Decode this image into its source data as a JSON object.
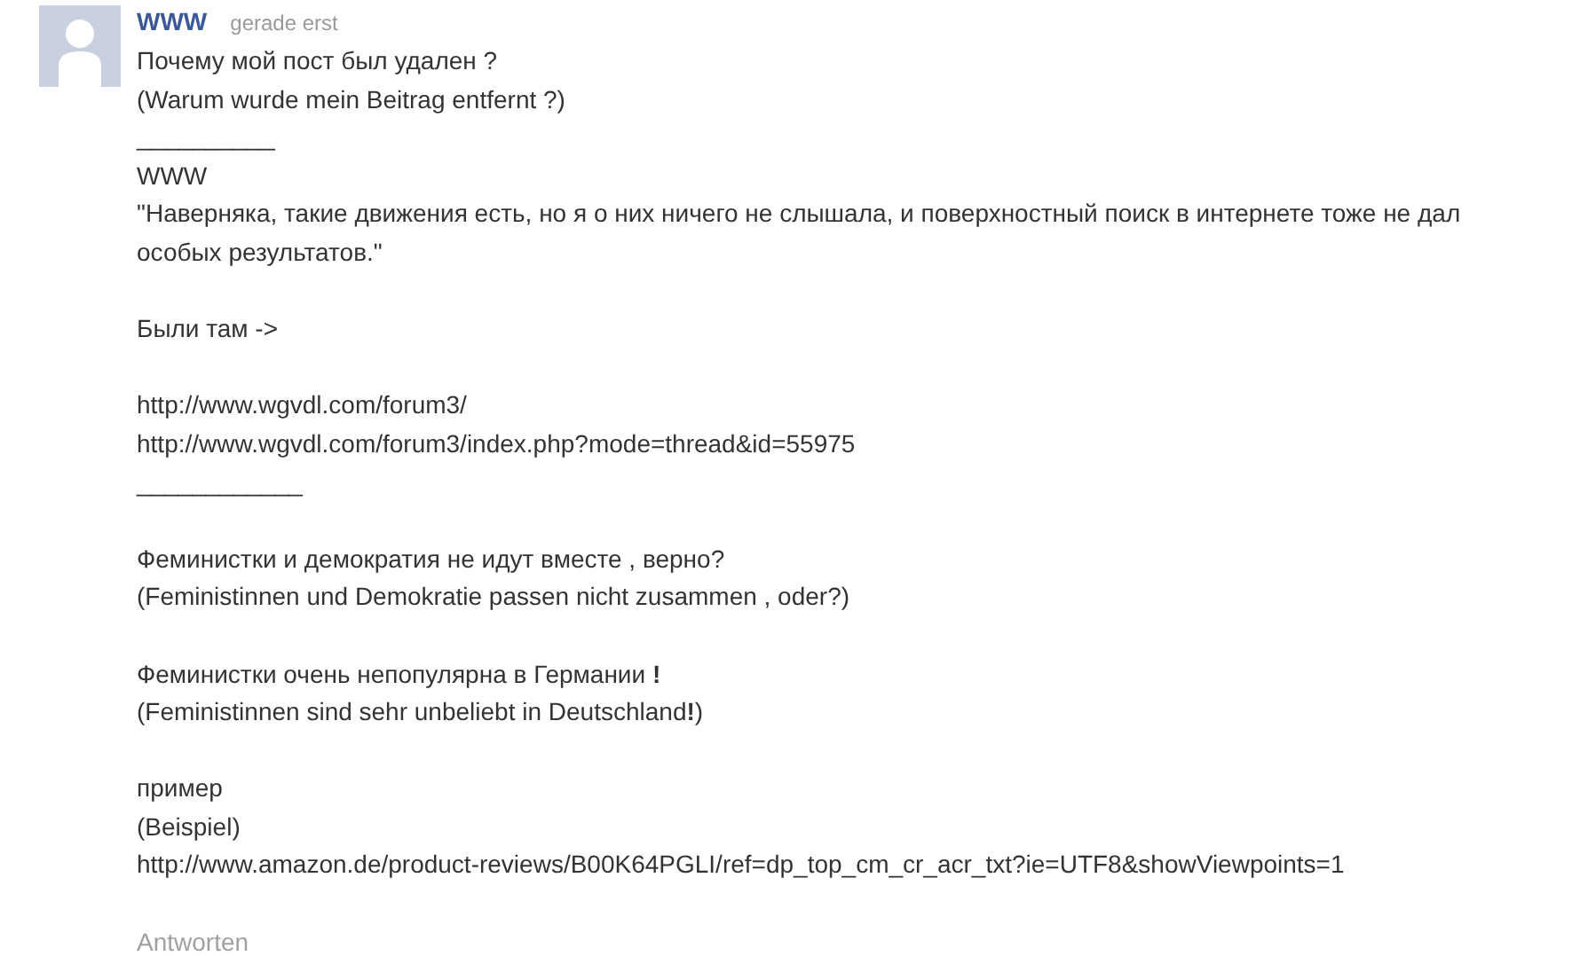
{
  "comment": {
    "author": "WWW",
    "time": "gerade erst",
    "blocks": [
      [
        "Почему мой пост был удален ?",
        "(Warum wurde mein Beitrag entfernt ?)",
        "__________",
        "WWW",
        "\"Наверняка, такие движения есть, но я о них ничего не слышала, и поверхностный поиск в интернете тоже не дал особых результатов.\""
      ],
      [
        "Были там ->"
      ],
      [
        "http://www.wgvdl.com/forum3/",
        "http://www.wgvdl.com/forum3/index.php?mode=thread&id=55975",
        "____________"
      ],
      [
        "Феминистки и демократия не идут вместе , верно?",
        "(Feministinnen und Demokratie passen nicht zusammen , oder?)"
      ],
      [
        "Феминистки очень непопулярна в Германии **!**",
        "(Feministinnen sind sehr unbeliebt in Deutschland**!**)"
      ],
      [
        "пример",
        "(Beispiel)",
        "http://www.amazon.de/product-reviews/B00K64PGLI/ref=dp_top_cm_cr_acr_txt?ie=UTF8&showViewpoints=1"
      ]
    ],
    "reply_link": "Antworten"
  }
}
